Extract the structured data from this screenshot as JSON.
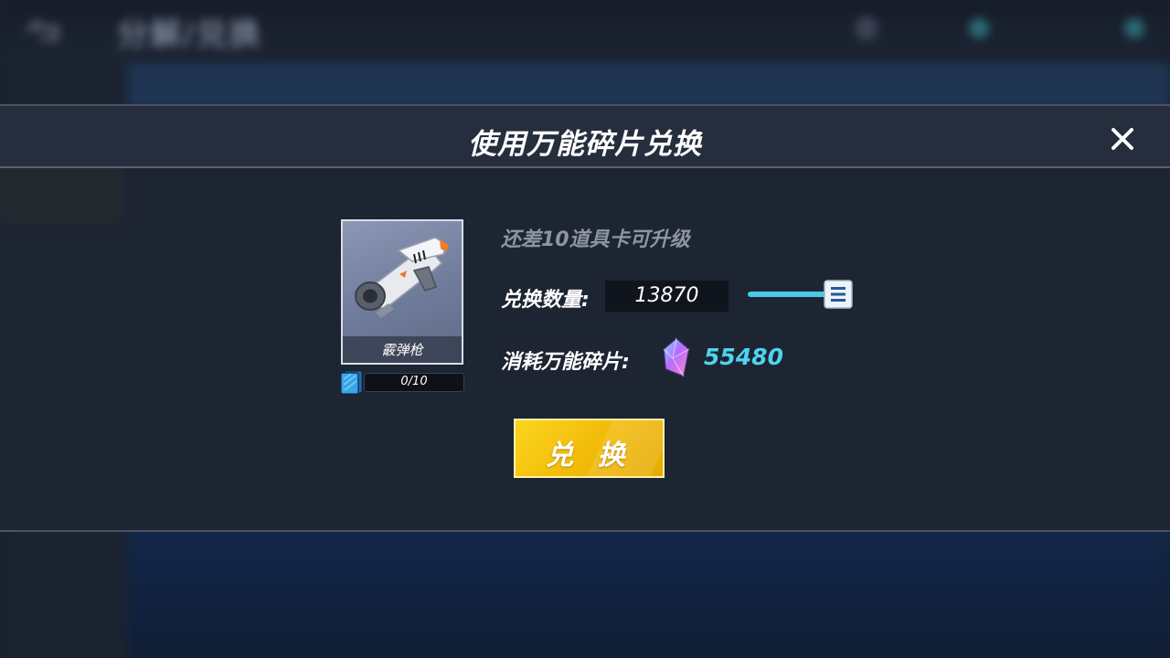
{
  "background": {
    "title": "分解/兑换"
  },
  "dialog": {
    "title": "使用万能碎片兑换",
    "item": {
      "name": "霰弹枪",
      "progress_text": "0/10",
      "progress_fraction": 0
    },
    "hint": "还差10道具卡可升级",
    "quantity_label": "兑换数量:",
    "quantity_value": "13870",
    "cost_label": "消耗万能碎片:",
    "cost_value": "55480",
    "exchange_button": "兑 换"
  },
  "icons": {
    "close": "close-icon",
    "slider_handle": "menu-lines-icon",
    "currency": "crystal-shard-icon",
    "card": "item-card-icon",
    "back": "back-arrow-icon"
  },
  "colors": {
    "accent_cyan": "#4fd3f0",
    "button_yellow": "#f2bc09",
    "progress_blue": "#2e9fe0"
  }
}
